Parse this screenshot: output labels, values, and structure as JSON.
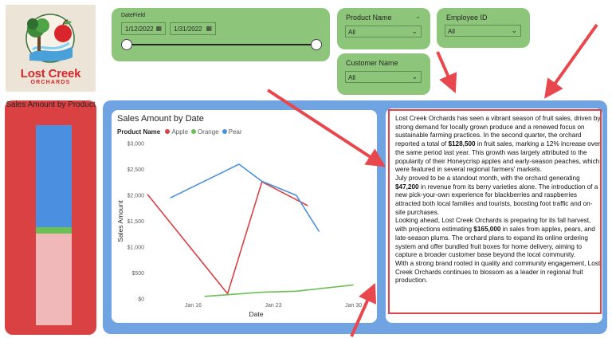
{
  "logo": {
    "line1": "Lost Creek",
    "line2": "ORCHARDS"
  },
  "date_slicer": {
    "label": "DateField",
    "start": "1/12/2022",
    "end": "1/31/2022"
  },
  "product_slicer": {
    "label": "Product Name",
    "value": "All"
  },
  "employee_slicer": {
    "label": "Employee ID",
    "value": "All"
  },
  "customer_slicer": {
    "label": "Customer Name",
    "value": "All"
  },
  "left_chart": {
    "title": "Sales Amount by Product",
    "segments": [
      {
        "name": "Pear",
        "fraction": 0.51,
        "color": "#4a8fe0"
      },
      {
        "name": "Orange",
        "fraction": 0.03,
        "color": "#6cbf54"
      },
      {
        "name": "Apple",
        "fraction": 0.46,
        "color": "#f0b8b8"
      }
    ]
  },
  "line_chart": {
    "title": "Sales Amount by Date",
    "legend_label": "Product Name",
    "xlabel": "Date",
    "ylabel": "Sales Amount"
  },
  "chart_data": {
    "type": "line",
    "title": "Sales Amount by Date",
    "xlabel": "Date",
    "ylabel": "Sales Amount",
    "ylim": [
      0,
      3000
    ],
    "xlim": [
      12,
      31
    ],
    "y_ticks": [
      "$0",
      "$500",
      "$1,000",
      "$1,500",
      "$2,000",
      "$2,500",
      "$3,000"
    ],
    "y_tick_values": [
      0,
      500,
      1000,
      1500,
      2000,
      2500,
      3000
    ],
    "x_ticks": [
      "Jan 16",
      "Jan 23",
      "Jan 30"
    ],
    "x_tick_values": [
      16,
      23,
      30
    ],
    "series": [
      {
        "name": "Apple",
        "color": "#d94142",
        "x": [
          12,
          19,
          22,
          26
        ],
        "y": [
          2020,
          100,
          2260,
          1800
        ]
      },
      {
        "name": "Orange",
        "color": "#6cbf54",
        "x": [
          17,
          22,
          25,
          30
        ],
        "y": [
          50,
          130,
          150,
          270
        ]
      },
      {
        "name": "Pear",
        "color": "#4a8fe0",
        "x": [
          14,
          20,
          22,
          25,
          27
        ],
        "y": [
          1950,
          2600,
          2270,
          2000,
          1300
        ]
      }
    ]
  },
  "text_card": {
    "p1_a": "Lost Creek Orchards has seen a vibrant season of fruit sales, driven by strong demand for locally grown produce and a renewed focus on sustainable farming practices. In the second quarter, the orchard reported a total of ",
    "p1_b": "$128,500",
    "p1_c": " in fruit sales, marking a 12% increase over the same period last year. This growth was largely attributed to the popularity of their Honeycrisp apples and early-season peaches, which were featured in several regional farmers' markets.",
    "p2_a": "July proved to be a standout month, with the orchard generating ",
    "p2_b": "$47,200",
    "p2_c": " in revenue from its berry varieties alone. The introduction of a new pick-your-own experience for blackberries and raspberries attracted both local families and tourists, boosting foot traffic and on-site purchases.",
    "p3_a": "Looking ahead, Lost Creek Orchards is preparing for its fall harvest, with projections estimating ",
    "p3_b": "$165,000",
    "p3_c": " in sales from apples, pears, and late-season plums. The orchard plans to expand its online ordering system and offer bundled fruit boxes for home delivery, aiming to capture a broader customer base beyond the local community.",
    "p4": "With a strong brand rooted in quality and community engagement, Lost Creek Orchards continues to blossom as a leader in regional fruit production."
  },
  "colors": {
    "slicer_green": "#8dc67a",
    "left_panel_red": "#d94142",
    "container_blue": "#6fa3e1",
    "annotation_red": "#e0424a"
  }
}
